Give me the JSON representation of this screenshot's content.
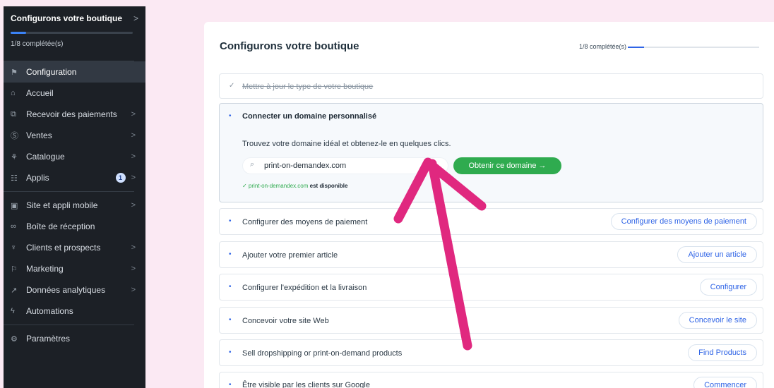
{
  "sidebar": {
    "header_title": "Configurons votre boutique",
    "header_chevron": ">",
    "progress": 0.125,
    "count_text": "1/8 complétée(s)",
    "items": [
      {
        "label": "Configuration",
        "icon": "rocket-icon",
        "glyph": "⚑",
        "chevron": ""
      },
      {
        "label": "Accueil",
        "icon": "home-icon",
        "glyph": "⌂",
        "chevron": ""
      },
      {
        "label": "Recevoir des paiements",
        "icon": "payment-icon",
        "glyph": "⧉",
        "chevron": ">"
      },
      {
        "label": "Ventes",
        "icon": "dollar-icon",
        "glyph": "Ⓢ",
        "chevron": ">"
      },
      {
        "label": "Catalogue",
        "icon": "catalog-icon",
        "glyph": "⚘",
        "chevron": ">"
      },
      {
        "label": "Applis",
        "icon": "apps-icon",
        "glyph": "☷",
        "chevron": ">",
        "badge": "1"
      },
      {
        "label": "Site et appli mobile",
        "icon": "site-icon",
        "glyph": "▣",
        "chevron": ">"
      },
      {
        "label": "Boîte de réception",
        "icon": "inbox-icon",
        "glyph": "∞",
        "chevron": ""
      },
      {
        "label": "Clients et prospects",
        "icon": "contacts-icon",
        "glyph": "♆",
        "chevron": ">"
      },
      {
        "label": "Marketing",
        "icon": "marketing-icon",
        "glyph": "⚐",
        "chevron": ">"
      },
      {
        "label": "Données analytiques",
        "icon": "analytics-icon",
        "glyph": "↗",
        "chevron": ">"
      },
      {
        "label": "Automations",
        "icon": "automation-icon",
        "glyph": "ϟ",
        "chevron": ""
      },
      {
        "label": "Paramètres",
        "icon": "settings-icon",
        "glyph": "⚙",
        "chevron": ""
      }
    ]
  },
  "main": {
    "title": "Configurons votre boutique",
    "progress_text": "1/8 complétée(s)",
    "progress": 0.125,
    "tasks": [
      {
        "title": "Mettre à jour le type de votre boutique",
        "status": "done",
        "marker": "✓"
      },
      {
        "title": "Connecter un domaine personnalisé",
        "status": "open",
        "marker": "•",
        "description": "Trouvez votre domaine idéal et obtenez-le en quelques clics.",
        "search_icon": "search-icon",
        "search_glyph": "⌕",
        "input_value": "print-on-demandex.com",
        "button": "Obtenir ce domaine →",
        "availability_check": "✓ print-on-demandex.com",
        "availability_text": "est disponible"
      },
      {
        "title": "Configurer des moyens de paiement",
        "status": "todo",
        "marker": "•",
        "button": "Configurer des moyens de paiement"
      },
      {
        "title": "Ajouter votre premier article",
        "status": "todo",
        "marker": "•",
        "button": "Ajouter un article"
      },
      {
        "title": "Configurer l'expédition et la livraison",
        "status": "todo",
        "marker": "•",
        "button": "Configurer"
      },
      {
        "title": "Concevoir votre site Web",
        "status": "todo",
        "marker": "•",
        "button": "Concevoir le site"
      },
      {
        "title": "Sell dropshipping or print-on-demand products",
        "status": "todo",
        "marker": "•",
        "button": "Find Products"
      },
      {
        "title": "Être visible par les clients sur Google",
        "status": "todo",
        "marker": "•",
        "button": "Commencer"
      }
    ]
  },
  "colors": {
    "page_bg": "#fbe9f3",
    "sidebar_bg": "#1c2026",
    "accent_blue": "#2f64e6",
    "success_green": "#2fab4f",
    "annotation_arrow": "#e0287f"
  }
}
